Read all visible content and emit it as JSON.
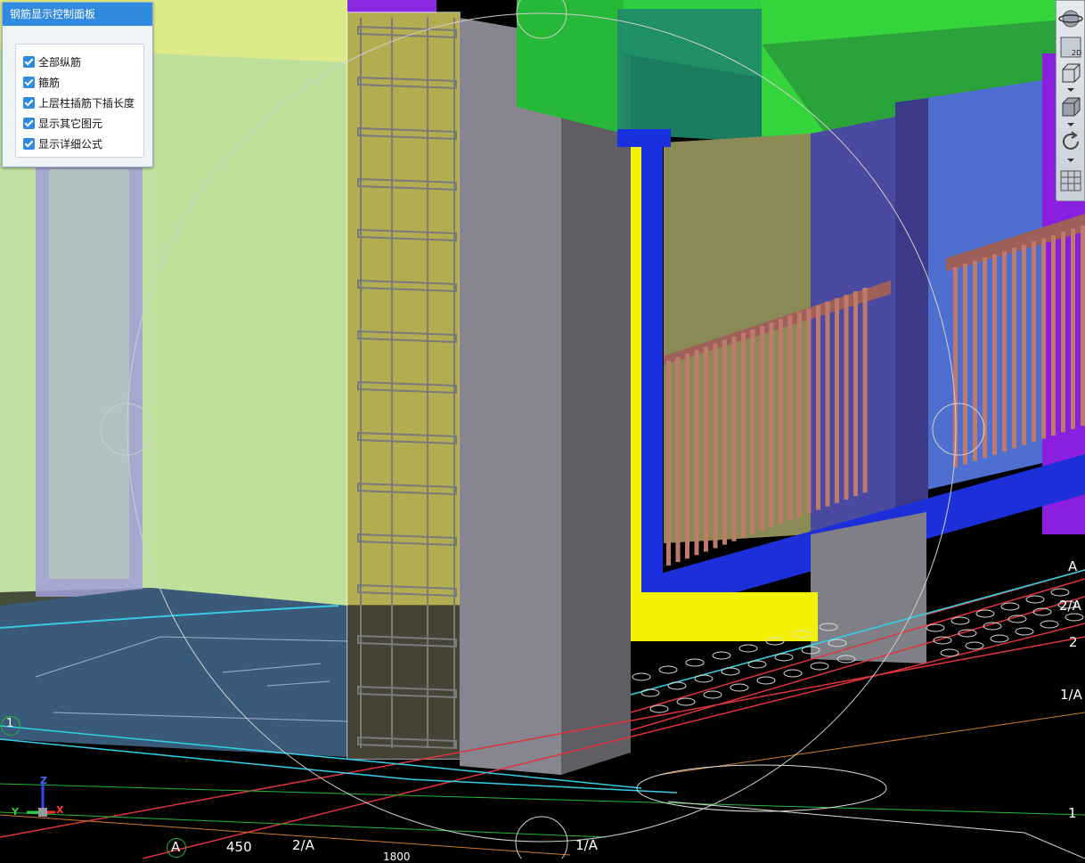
{
  "panel": {
    "title": "钢筋显示控制面板",
    "options": [
      {
        "label": "全部纵筋",
        "checked": true
      },
      {
        "label": "箍筋",
        "checked": true
      },
      {
        "label": "上层柱插筋下插长度",
        "checked": true
      },
      {
        "label": "显示其它图元",
        "checked": true
      },
      {
        "label": "显示详细公式",
        "checked": true
      }
    ]
  },
  "toolbar": {
    "tools": [
      {
        "icon": "orbit-sphere-icon"
      },
      {
        "icon": "view-2d-icon",
        "label": "2D"
      },
      {
        "icon": "view-3d-box-icon"
      },
      {
        "icon": "solid-box-icon"
      },
      {
        "icon": "rotate-icon"
      },
      {
        "icon": "grid-table-icon"
      }
    ]
  },
  "axes": {
    "x": "X",
    "y": "Y",
    "z": "Z"
  },
  "grid_labels": {
    "bottom": [
      "A",
      "450",
      "2/A",
      "1/A",
      "1800"
    ],
    "right": [
      "A",
      "2/A",
      "2",
      "1/A",
      "1"
    ],
    "left": [
      "1"
    ]
  },
  "colors": {
    "panel_title": "#2f8ae0",
    "green_beam": "#2ecc40",
    "blue_beam": "#1d2fd8",
    "purple_wall": "#7a00c9",
    "railing": "#b06a5c"
  }
}
